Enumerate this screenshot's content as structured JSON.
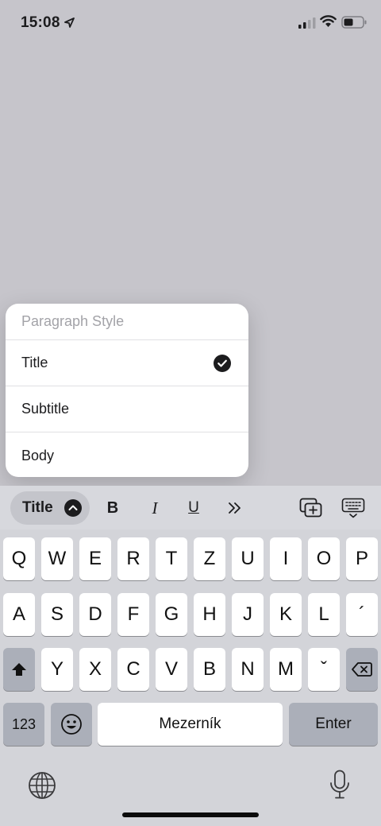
{
  "status_bar": {
    "time": "15:08",
    "icons": [
      "location-arrow-icon",
      "cellular-signal-icon",
      "wifi-icon",
      "battery-icon"
    ]
  },
  "popover": {
    "header": "Paragraph Style",
    "items": [
      {
        "label": "Title",
        "selected": true
      },
      {
        "label": "Subtitle",
        "selected": false
      },
      {
        "label": "Body",
        "selected": false
      }
    ]
  },
  "toolbar": {
    "style_label": "Title",
    "bold": "B",
    "italic": "I",
    "underline": "U",
    "more": "»"
  },
  "keyboard": {
    "row1": [
      "Q",
      "W",
      "E",
      "R",
      "T",
      "Z",
      "U",
      "I",
      "O",
      "P"
    ],
    "row2": [
      "A",
      "S",
      "D",
      "F",
      "G",
      "H",
      "J",
      "K",
      "L",
      "´"
    ],
    "row3": [
      "Y",
      "X",
      "C",
      "V",
      "B",
      "N",
      "M",
      "ˇ"
    ],
    "numbers_key": "123",
    "space_key": "Mezerník",
    "enter_key": "Enter"
  },
  "colors": {
    "background": "#c6c5cb",
    "keyboard": "#d3d4d9",
    "key": "#ffffff",
    "dark_key": "#abafb9",
    "menu_header": "#a3a3a8"
  }
}
